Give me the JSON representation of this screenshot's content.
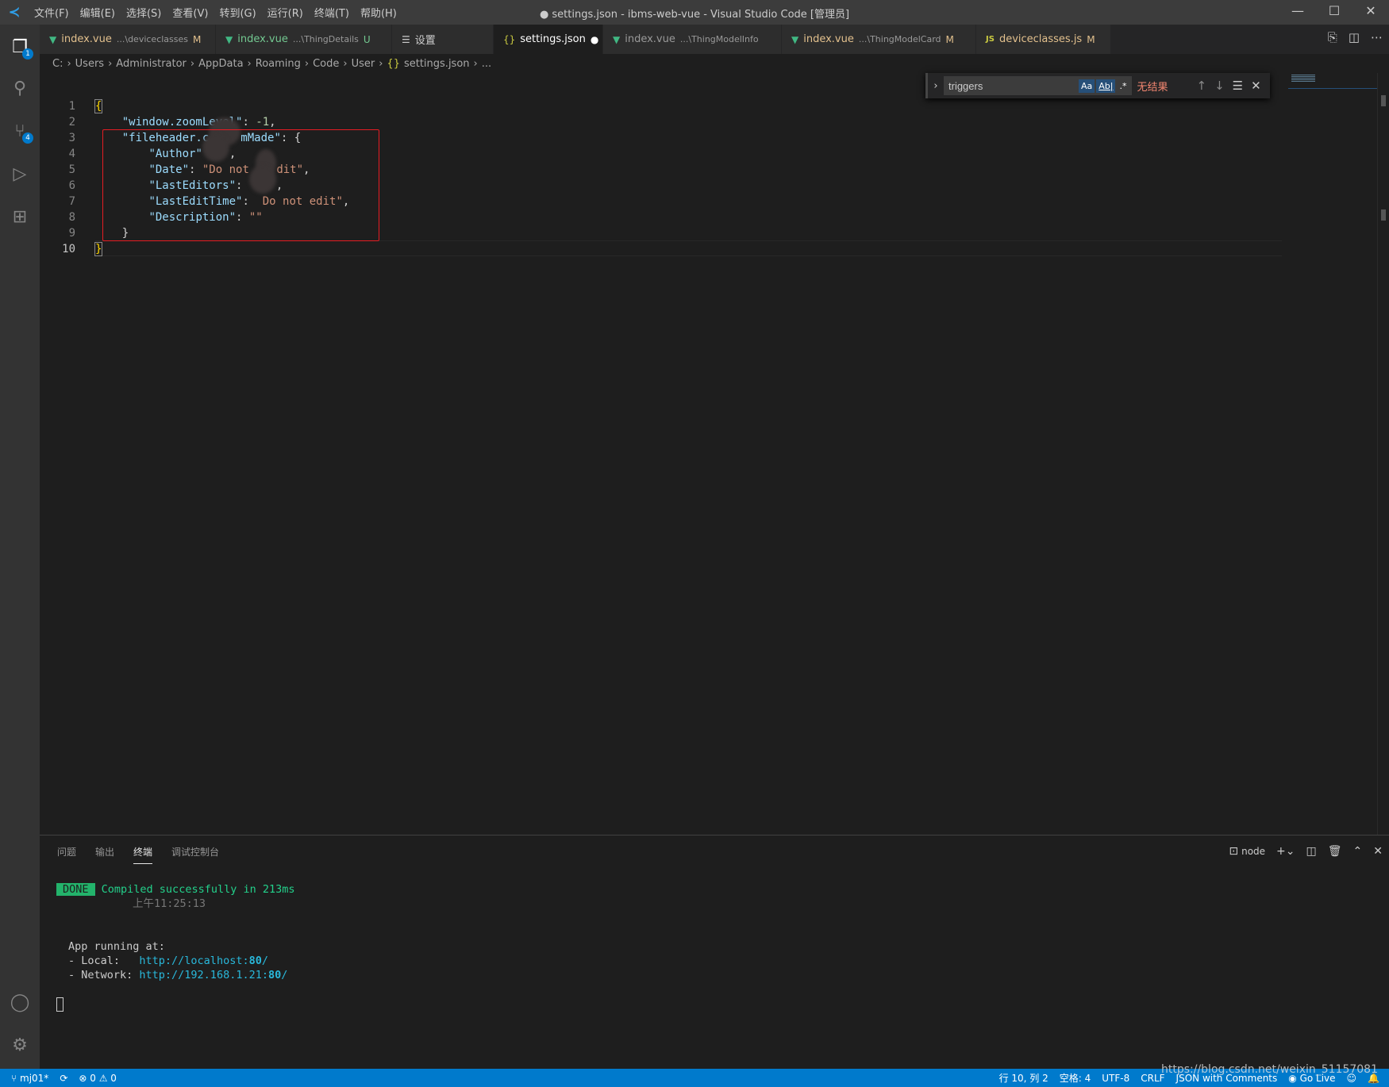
{
  "titlebar": {
    "menus": [
      "文件(F)",
      "编辑(E)",
      "选择(S)",
      "查看(V)",
      "转到(G)",
      "运行(R)",
      "终端(T)",
      "帮助(H)"
    ],
    "title": "● settings.json - ibms-web-vue - Visual Studio Code [管理员]"
  },
  "activity": {
    "explorer_badge": "1",
    "scm_badge": "4"
  },
  "tabs": [
    {
      "icon": "vue-icon",
      "label": "index.vue",
      "desc": "...\\deviceclasses",
      "status": "M"
    },
    {
      "icon": "vue-icon",
      "label": "index.vue",
      "desc": "...\\ThingDetails",
      "status": "U"
    },
    {
      "icon": "settings-list-icon",
      "label": "设置",
      "desc": "",
      "status": ""
    },
    {
      "icon": "json-icon",
      "label": "settings.json",
      "desc": "",
      "status": "●"
    },
    {
      "icon": "vue-icon",
      "label": "index.vue",
      "desc": "...\\ThingModelInfo",
      "status": ""
    },
    {
      "icon": "vue-icon",
      "label": "index.vue",
      "desc": "...\\ThingModelCard",
      "status": "M"
    },
    {
      "icon": "js-icon",
      "label": "deviceclasses.js",
      "desc": "",
      "status": "M"
    }
  ],
  "breadcrumb": [
    "C:",
    "Users",
    "Administrator",
    "AppData",
    "Roaming",
    "Code",
    "User",
    "settings.json",
    "..."
  ],
  "editor": {
    "line_numbers": [
      "1",
      "2",
      "3",
      "4",
      "5",
      "6",
      "7",
      "8",
      "9",
      "10"
    ],
    "code": {
      "l1": "{",
      "l2_key": "\"window.zoomLevel\"",
      "l2_val": "-1",
      "l3_key_a": "\"fileheader.c",
      "l3_key_b": "mMade\"",
      "l4_key": "\"Author\"",
      "l5_key": "\"Date\"",
      "l5_val_a": "\"Do not ",
      "l5_val_b": "dit\"",
      "l6_key": "\"LastEditors\"",
      "l7_key": "\"LastEditTime\"",
      "l7_val": "Do not edit\"",
      "l8_key": "\"Description\"",
      "l8_val": "\"\"",
      "l9": "}",
      "l10": "}"
    }
  },
  "find": {
    "value": "triggers",
    "match_case": "Aa",
    "whole_word": "Ab|",
    "regex": ".*",
    "result": "无结果"
  },
  "panel": {
    "tabs": [
      "问题",
      "输出",
      "终端",
      "调试控制台"
    ],
    "active_tab": "终端",
    "terminal_name": "node",
    "lines": {
      "done": "DONE",
      "compiled": "Compiled successfully in 213ms",
      "time": "上午11:25:13",
      "app": "App running at:",
      "local_label": "- Local:   ",
      "local_url": "http://localhost:",
      "local_port": "80",
      "network_label": "- Network: ",
      "network_url": "http://192.168.1.21:",
      "network_port": "80",
      "slash": "/"
    }
  },
  "status": {
    "branch": "mj01*",
    "errors": "0",
    "warnings": "0",
    "position": "行 10, 列 2",
    "spaces": "空格: 4",
    "encoding": "UTF-8",
    "eol": "CRLF",
    "language": "JSON with Comments",
    "golive": "Go Live"
  },
  "watermark": "https://blog.csdn.net/weixin_51157081",
  "colors": {
    "accent": "#007acc",
    "highlight_box": "#e51c23",
    "done": "#23b36b"
  }
}
